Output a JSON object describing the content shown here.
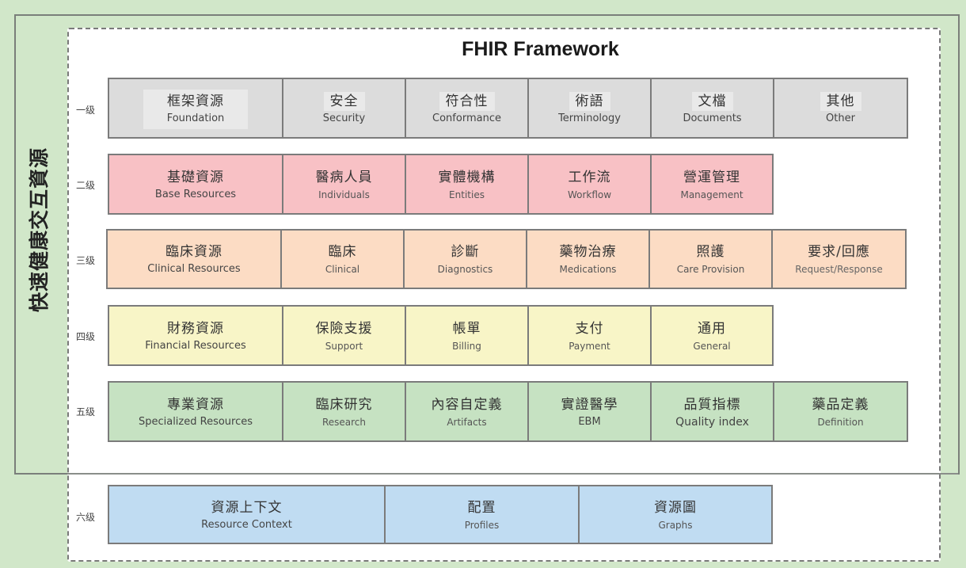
{
  "title": "FHIR Framework",
  "side_label": "快速健康交互資源",
  "colors": {
    "background": "#d1e7c9",
    "level1": "#dcdcdc",
    "level2": "#f8c1c5",
    "level3": "#fcdcc4",
    "level4": "#f8f5c7",
    "level5": "#c6e2c2",
    "level6": "#c0dcf2"
  },
  "levels": [
    {
      "label": "一级",
      "cells": [
        {
          "zh": "框架資源",
          "en": "Foundation"
        },
        {
          "zh": "安全",
          "en": "Security"
        },
        {
          "zh": "符合性",
          "en": "Conformance"
        },
        {
          "zh": "術語",
          "en": "Terminology"
        },
        {
          "zh": "文檔",
          "en": "Documents"
        },
        {
          "zh": "其他",
          "en": "Other"
        }
      ]
    },
    {
      "label": "二级",
      "cells": [
        {
          "zh": "基礎資源",
          "en": "Base Resources"
        },
        {
          "zh": "醫病人員",
          "en": "Individuals"
        },
        {
          "zh": "實體機構",
          "en": "Entities"
        },
        {
          "zh": "工作流",
          "en": "Workflow"
        },
        {
          "zh": "營運管理",
          "en": "Management"
        }
      ]
    },
    {
      "label": "三级",
      "cells": [
        {
          "zh": "臨床資源",
          "en": "Clinical Resources"
        },
        {
          "zh": "臨床",
          "en": "Clinical"
        },
        {
          "zh": "診斷",
          "en": "Diagnostics"
        },
        {
          "zh": "藥物治療",
          "en": "Medications"
        },
        {
          "zh": "照護",
          "en": "Care Provision"
        },
        {
          "zh": "要求/回應",
          "en": "Request/Response"
        }
      ]
    },
    {
      "label": "四级",
      "cells": [
        {
          "zh": "財務資源",
          "en": "Financial Resources"
        },
        {
          "zh": "保險支援",
          "en": "Support"
        },
        {
          "zh": "帳單",
          "en": "Billing"
        },
        {
          "zh": "支付",
          "en": "Payment"
        },
        {
          "zh": "通用",
          "en": "General"
        }
      ]
    },
    {
      "label": "五级",
      "cells": [
        {
          "zh": "專業資源",
          "en": "Specialized Resources"
        },
        {
          "zh": "臨床研究",
          "en": "Research"
        },
        {
          "zh": "內容自定義",
          "en": "Artifacts"
        },
        {
          "zh": "實證醫學",
          "en": "EBM"
        },
        {
          "zh": "品質指標",
          "en": "Quality index"
        },
        {
          "zh": "藥品定義",
          "en": "Definition"
        }
      ]
    },
    {
      "label": "六级",
      "cells": [
        {
          "zh": "資源上下文",
          "en": "Resource Context"
        },
        {
          "zh": "配置",
          "en": "Profiles"
        },
        {
          "zh": "資源圖",
          "en": "Graphs"
        }
      ]
    }
  ]
}
